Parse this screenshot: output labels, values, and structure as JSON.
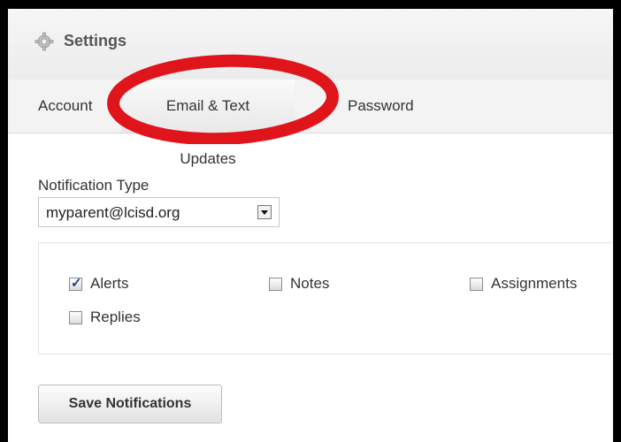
{
  "header": {
    "title": "Settings",
    "icon": "gear-icon"
  },
  "tabs": [
    {
      "label": "Account"
    },
    {
      "label": "Email & Text Updates",
      "active": true
    },
    {
      "label": "Password"
    }
  ],
  "form": {
    "notification_type_label": "Notification Type",
    "notification_type_value": "myparent@lcisd.org",
    "options": [
      {
        "label": "Alerts",
        "checked": true
      },
      {
        "label": "Notes",
        "checked": false
      },
      {
        "label": "Assignments",
        "checked": false
      },
      {
        "label": "Replies",
        "checked": false
      }
    ],
    "save_label": "Save Notifications"
  },
  "annotation_color": "#e0141b"
}
